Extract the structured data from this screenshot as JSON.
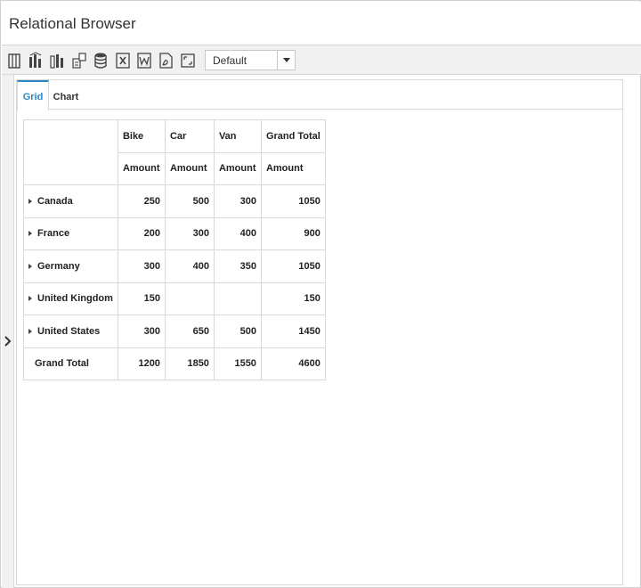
{
  "window": {
    "title": "Relational Browser"
  },
  "toolbar": {
    "icons": [
      "grid-view-icon",
      "chart-view-icon",
      "grid-chart-view-icon",
      "mdx-query-icon",
      "report-database-icon",
      "export-excel-icon",
      "export-word-icon",
      "export-pdf-icon",
      "fullscreen-icon"
    ],
    "report_select": {
      "value": "Default"
    }
  },
  "tabs": [
    {
      "label": "Grid",
      "active": true
    },
    {
      "label": "Chart",
      "active": false
    }
  ],
  "grid": {
    "columns": [
      "Bike",
      "Car",
      "Van",
      "Grand Total"
    ],
    "measures": [
      "Amount",
      "Amount",
      "Amount",
      "Amount"
    ],
    "rows": [
      {
        "label": "Canada",
        "values": [
          "250",
          "500",
          "300",
          "1050"
        ]
      },
      {
        "label": "France",
        "values": [
          "200",
          "300",
          "400",
          "900"
        ]
      },
      {
        "label": "Germany",
        "values": [
          "300",
          "400",
          "350",
          "1050"
        ]
      },
      {
        "label": "United Kingdom",
        "values": [
          "150",
          "",
          "",
          "150"
        ]
      },
      {
        "label": "United States",
        "values": [
          "300",
          "650",
          "500",
          "1450"
        ]
      }
    ],
    "total": {
      "label": "Grand Total",
      "values": [
        "1200",
        "1850",
        "1550",
        "4600"
      ]
    }
  },
  "colors": {
    "accent": "#2e86c1",
    "toolbar_bg": "#f1f1f1",
    "border": "#d8d8d8"
  }
}
